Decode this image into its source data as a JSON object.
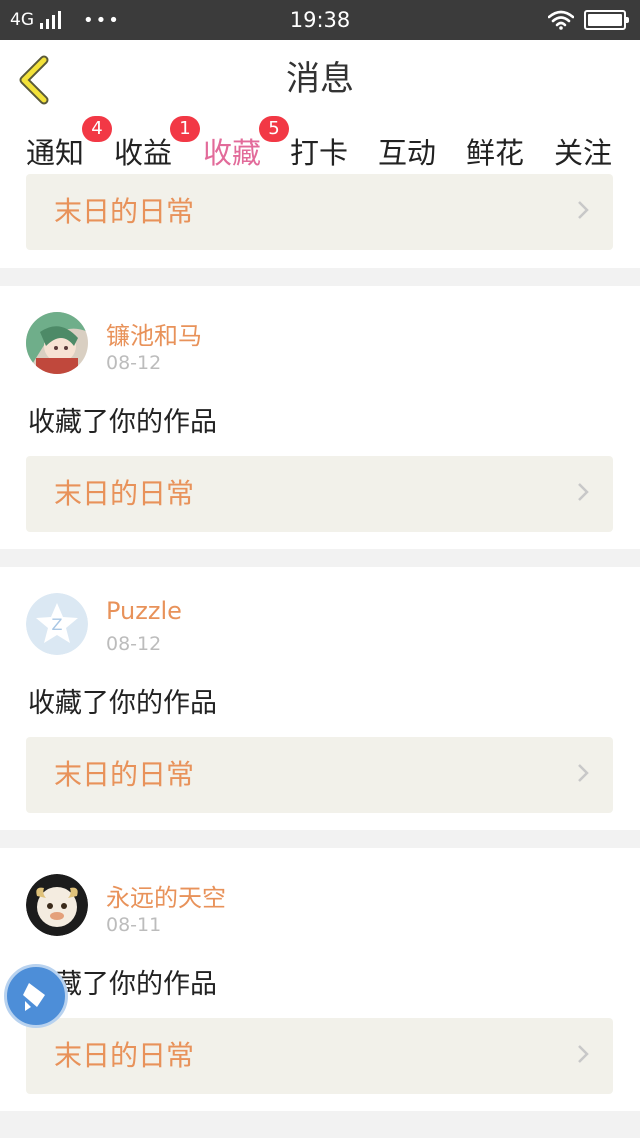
{
  "status_bar": {
    "network": "4G",
    "dots": "•••",
    "time": "19:38"
  },
  "nav": {
    "title": "消息",
    "back_icon": "chevron-left-icon"
  },
  "tabs": [
    {
      "label": "通知",
      "badge": "4"
    },
    {
      "label": "收益",
      "badge": "1"
    },
    {
      "label": "收藏",
      "badge": "5",
      "active": true
    },
    {
      "label": "打卡"
    },
    {
      "label": "互动"
    },
    {
      "label": "鲜花"
    },
    {
      "label": "关注"
    }
  ],
  "first_work": {
    "title": "末日的日常"
  },
  "messages": [
    {
      "user": "镰池和马",
      "date": "08-12",
      "action": "收藏了你的作品",
      "work_title": "末日的日常",
      "avatar": "anime-girl-avatar"
    },
    {
      "user": "Puzzle",
      "date": "08-12",
      "action": "收藏了你的作品",
      "work_title": "末日的日常",
      "avatar": "default-star-avatar"
    },
    {
      "user": "永远的天空",
      "date": "08-11",
      "action": "收藏了你的作品",
      "work_title": "末日的日常",
      "avatar": "cartoon-goat-avatar"
    }
  ],
  "colors": {
    "accent": "#e26b9a",
    "name": "#e8925a",
    "badge": "#f23845",
    "card": "#f2f1ea"
  }
}
